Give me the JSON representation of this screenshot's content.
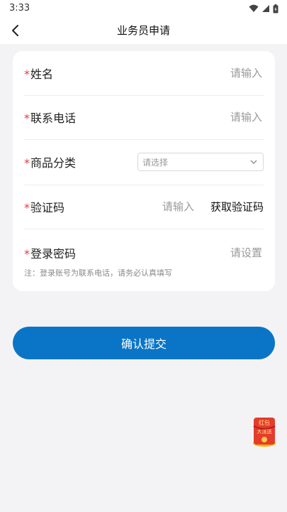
{
  "status": {
    "time": "3:33"
  },
  "header": {
    "title": "业务员申请"
  },
  "form": {
    "required_mark": "*",
    "name": {
      "label": "姓名",
      "placeholder": "请输入"
    },
    "phone": {
      "label": "联系电话",
      "placeholder": "请输入"
    },
    "category": {
      "label": "商品分类",
      "placeholder": "请选择"
    },
    "code": {
      "label": "验证码",
      "placeholder": "请输入",
      "get_code": "获取验证码"
    },
    "password": {
      "label": "登录密码",
      "placeholder": "请设置"
    },
    "note": "注：登录账号为联系电话，请务必认真填写"
  },
  "submit_label": "确认提交",
  "float_badge": {
    "line1": "红包",
    "line2": "大派送"
  },
  "colors": {
    "primary": "#0a75c6",
    "required": "#e23d3d",
    "background": "#f3f3f6"
  }
}
